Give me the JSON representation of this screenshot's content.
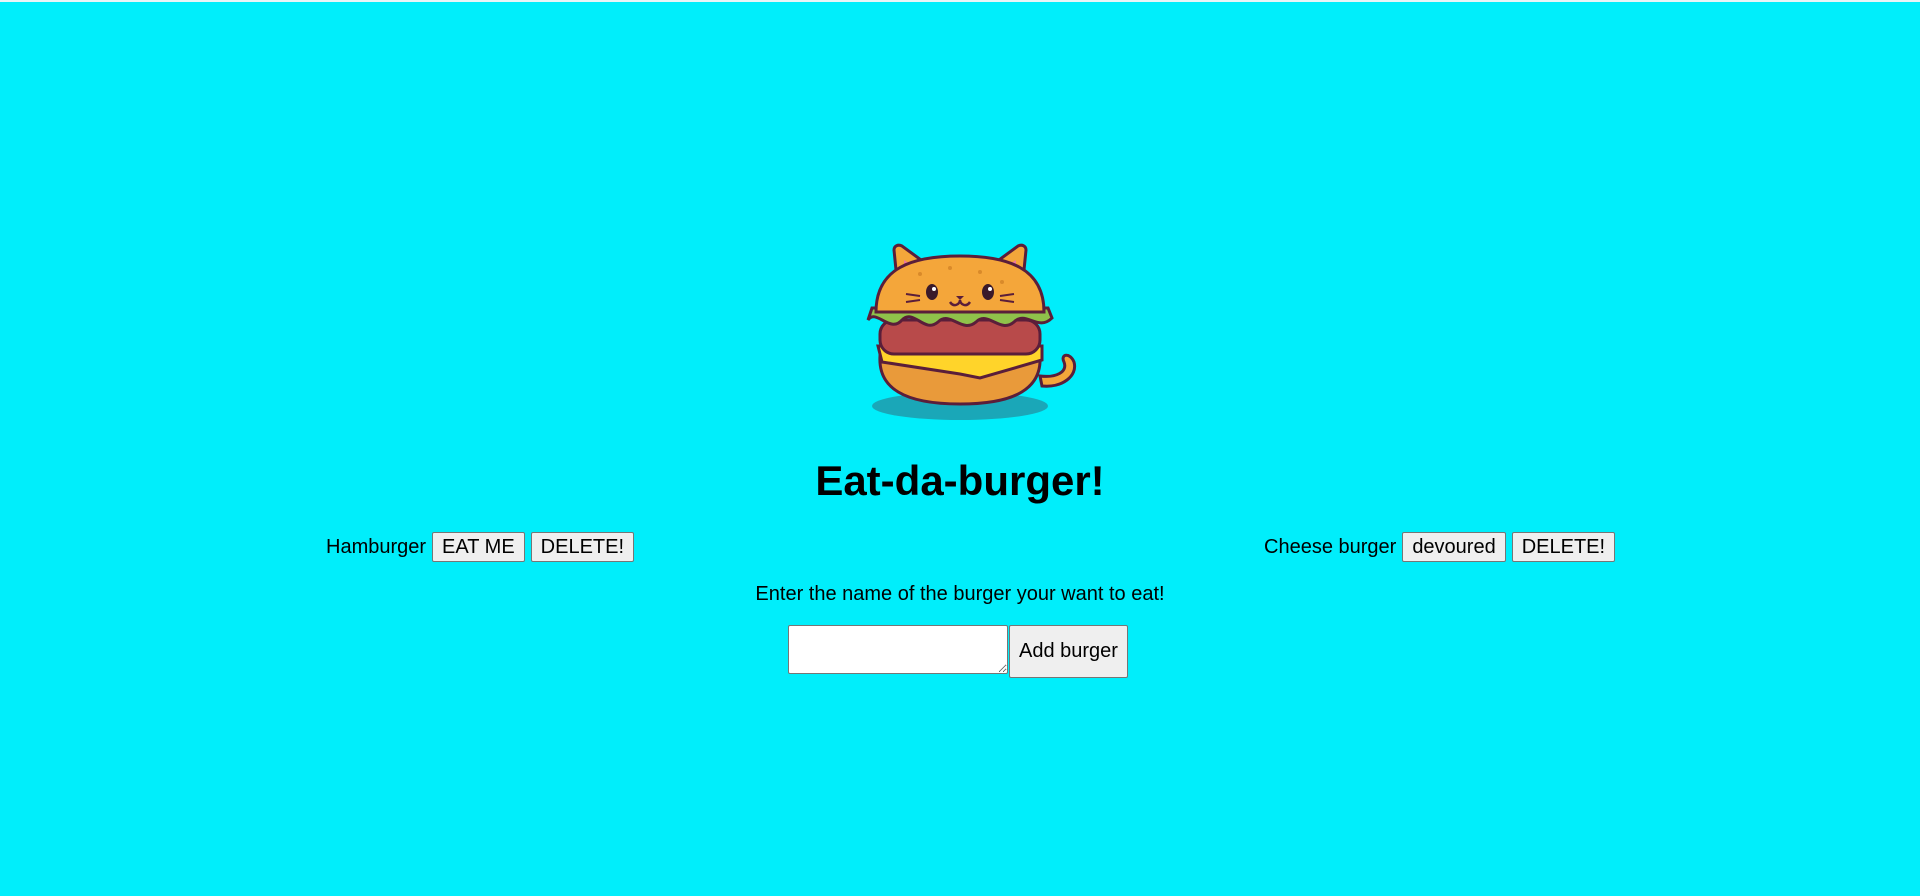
{
  "page": {
    "title": "Eat-da-burger!",
    "background_color": "#00eefb"
  },
  "logo": {
    "icon": "cat-burger-icon"
  },
  "burgers": {
    "left": {
      "name": "Hamburger",
      "action_label": "EAT ME",
      "delete_label": "DELETE!"
    },
    "right": {
      "name": "Cheese burger",
      "action_label": "devoured",
      "delete_label": "DELETE!"
    }
  },
  "form": {
    "prompt": "Enter the name of the burger your want to eat!",
    "input_value": "",
    "submit_label": "Add burger"
  }
}
